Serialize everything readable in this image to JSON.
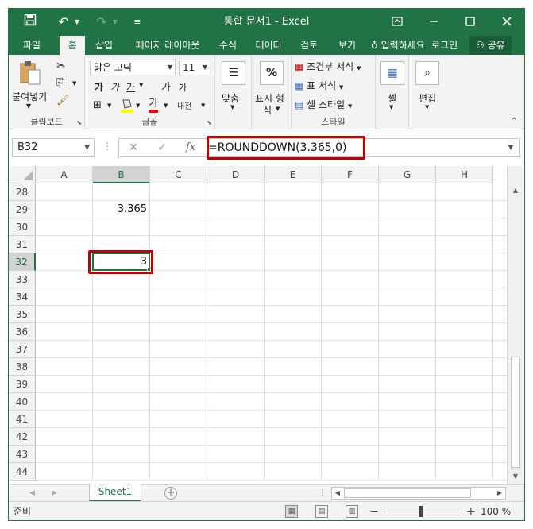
{
  "window": {
    "title": "통합 문서1 - Excel",
    "icons": {
      "save": "save-icon",
      "undo": "undo-icon",
      "redo": "redo-icon",
      "customize": "qat-customize-icon",
      "ribbon_display": "ribbon-display-icon",
      "minimize": "minimize-icon",
      "maximize": "maximize-icon",
      "close": "close-icon"
    }
  },
  "tabs": [
    "파일",
    "홈",
    "삽입",
    "페이지 레이아웃",
    "수식",
    "데이터",
    "검토",
    "보기"
  ],
  "tell_me": "입력하세요",
  "signin": "로그인",
  "share": "공유",
  "ribbon": {
    "clipboard": {
      "label": "클립보드",
      "paste": "붙여넣기"
    },
    "font": {
      "label": "글꼴",
      "name": "맑은 고딕",
      "size": "11",
      "bold": "가",
      "italic": "가",
      "underline": "가",
      "grow": "가",
      "shrink": "가",
      "color": "가",
      "phonetic": "내천"
    },
    "alignment": {
      "label": "맞춤"
    },
    "number": {
      "label": "표시 형식",
      "label_wrapped": [
        "표시 형",
        "식"
      ],
      "symbol": "%"
    },
    "styles": {
      "label": "스타일",
      "conditional": "조건부 서식",
      "table": "표 서식",
      "cell_styles": "셀 스타일"
    },
    "cells": {
      "label": "셀"
    },
    "editing": {
      "label": "편집"
    }
  },
  "formula_bar": {
    "name_box": "B32",
    "formula": "=ROUNDDOWN(3.365,0)",
    "fx": "fx"
  },
  "columns": [
    "A",
    "B",
    "C",
    "D",
    "E",
    "F",
    "G",
    "H"
  ],
  "rows": [
    "28",
    "29",
    "30",
    "31",
    "32",
    "33",
    "34",
    "35",
    "36",
    "37",
    "38",
    "39",
    "40",
    "41",
    "42",
    "43",
    "44"
  ],
  "cells": {
    "B29": "3.365",
    "B32": "3"
  },
  "sheets": [
    "Sheet1"
  ],
  "status": {
    "mode": "준비",
    "zoom": "100 %"
  },
  "accent": "#217346",
  "highlight": "#c00000"
}
